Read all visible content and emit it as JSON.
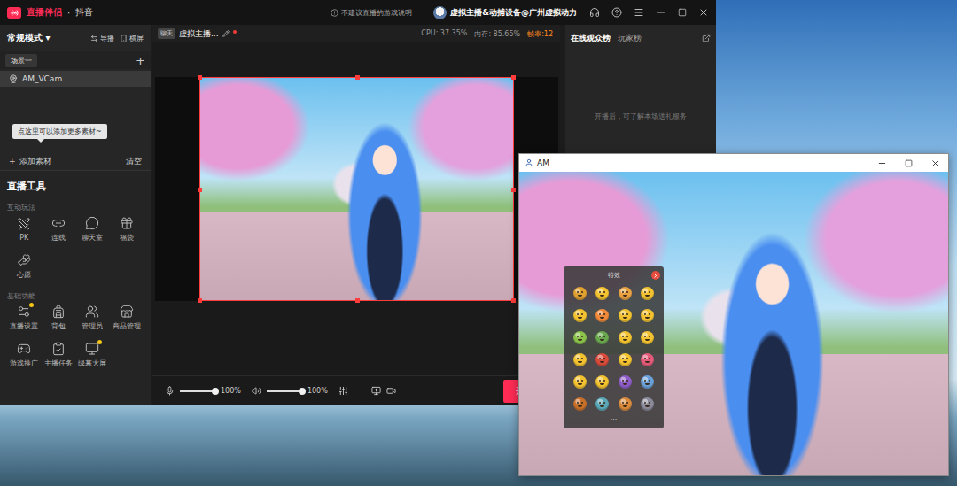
{
  "main_window": {
    "app_name": "直播伴侣",
    "separator": "·",
    "platform": "抖音",
    "notice": "不建议直播的游戏说明",
    "user": "虚拟主播&动捕设备@广州虚拟动力"
  },
  "mode": {
    "label": "常规模式",
    "caret": "▾"
  },
  "mode_actions": [
    {
      "label": "导播"
    },
    {
      "label": "横屏"
    }
  ],
  "scene_tabs": [
    {
      "label": "场景一",
      "selected": true
    }
  ],
  "add_scene": "+",
  "sources": [
    {
      "name": "AM_VCam",
      "selected": true
    }
  ],
  "tooltip": "点这里可以添加更多素材~",
  "add_source": {
    "icon": "+",
    "label": "添加素材"
  },
  "clear": "清空",
  "tools": {
    "title": "直播工具",
    "groups": [
      {
        "title": "互动玩法",
        "items": [
          {
            "label": "PK",
            "badge": false
          },
          {
            "label": "连线",
            "badge": false
          },
          {
            "label": "聊天室",
            "badge": false
          },
          {
            "label": "福袋",
            "badge": false
          },
          {
            "label": "心愿",
            "badge": false
          }
        ]
      },
      {
        "title": "基础功能",
        "items": [
          {
            "label": "直播设置",
            "badge": true
          },
          {
            "label": "背包",
            "badge": false
          },
          {
            "label": "管理员",
            "badge": false
          },
          {
            "label": "商品管理",
            "badge": false
          },
          {
            "label": "游戏推广",
            "badge": false
          },
          {
            "label": "主播任务",
            "badge": false
          },
          {
            "label": "绿幕大屏",
            "badge": true
          }
        ]
      }
    ]
  },
  "room": {
    "tag": "聊天",
    "title": "虚拟主播...",
    "unsaved": true
  },
  "stats": [
    {
      "label": "CPU: 37.35%",
      "warn": false
    },
    {
      "label": "内存: 85.65%",
      "warn": false
    },
    {
      "label": "帧率:12",
      "warn": true
    }
  ],
  "preview": {
    "selected": true
  },
  "audio": [
    {
      "kind": "mic",
      "level": 1,
      "reading": "100%"
    },
    {
      "kind": "speaker",
      "level": 1,
      "reading": "100%"
    }
  ],
  "start_button": "开始",
  "ranking": {
    "tabs": [
      {
        "label": "在线观众榜",
        "selected": true
      },
      {
        "label": "玩家榜",
        "selected": false
      }
    ],
    "empty": "开播后，可了解本场送礼服务"
  },
  "am_window": {
    "title": "AM",
    "effects_panel": {
      "title": "特效",
      "more": "···",
      "effects": [
        {
          "color": "#e0a030"
        },
        {
          "color": "#f2c230"
        },
        {
          "color": "#e8a040"
        },
        {
          "color": "#f2c230"
        },
        {
          "color": "#f2c230"
        },
        {
          "color": "#f08a3a"
        },
        {
          "color": "#f2c230"
        },
        {
          "color": "#f2c230"
        },
        {
          "color": "#8bc34a"
        },
        {
          "color": "#6aa84f"
        },
        {
          "color": "#f2c230"
        },
        {
          "color": "#f2c230"
        },
        {
          "color": "#f2c230"
        },
        {
          "color": "#d84a3a"
        },
        {
          "color": "#f2c230"
        },
        {
          "color": "#e45a7a"
        },
        {
          "color": "#f2c230"
        },
        {
          "color": "#f2c230"
        },
        {
          "color": "#8e5cc8"
        },
        {
          "color": "#6aa0d8"
        },
        {
          "color": "#c8702a"
        },
        {
          "color": "#5aa8b8"
        },
        {
          "color": "#d88a3a"
        },
        {
          "color": "#8a8a9a"
        }
      ]
    }
  }
}
